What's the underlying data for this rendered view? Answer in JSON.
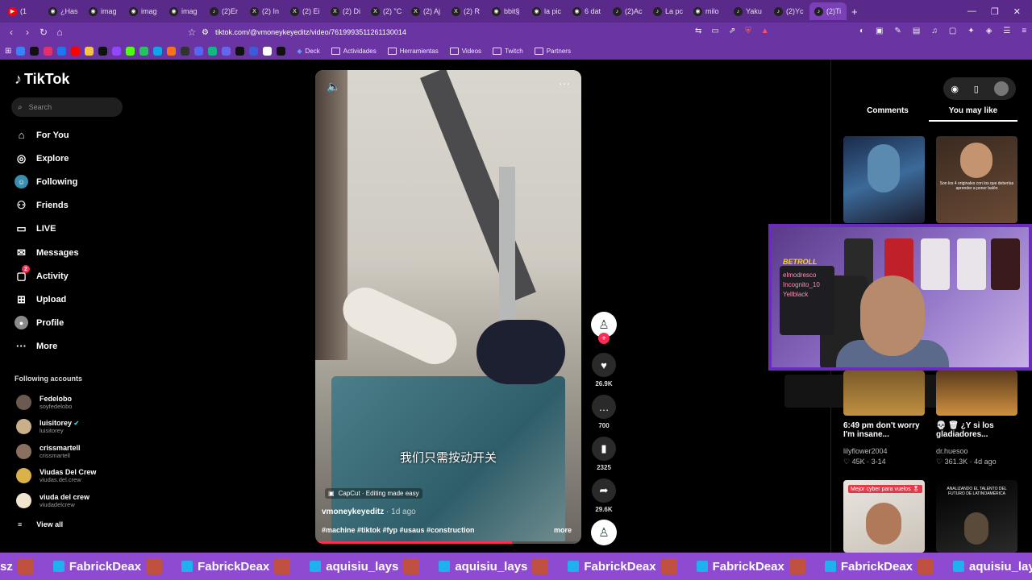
{
  "browser": {
    "tabs": [
      {
        "label": "(1",
        "icon": "youtube-icon"
      },
      {
        "label": "¿Has",
        "icon": "tab-icon"
      },
      {
        "label": "imag",
        "icon": "tab-icon"
      },
      {
        "label": "imag",
        "icon": "tab-icon"
      },
      {
        "label": "imag",
        "icon": "tab-icon"
      },
      {
        "label": "(2)Er",
        "icon": "tiktok-icon"
      },
      {
        "label": "(2) In",
        "icon": "x-icon"
      },
      {
        "label": "(2) Ei",
        "icon": "x-icon"
      },
      {
        "label": "(2) Di",
        "icon": "x-icon"
      },
      {
        "label": "(2) \"C",
        "icon": "x-icon"
      },
      {
        "label": "(2) Aj",
        "icon": "x-icon"
      },
      {
        "label": "(2) R",
        "icon": "x-icon"
      },
      {
        "label": "bbit§",
        "icon": "tab-icon"
      },
      {
        "label": "la pic",
        "icon": "tab-icon"
      },
      {
        "label": "6 dat",
        "icon": "tab-icon"
      },
      {
        "label": "(2)Ac",
        "icon": "tiktok-icon"
      },
      {
        "label": "La pc",
        "icon": "tiktok-icon"
      },
      {
        "label": "milo",
        "icon": "tab-icon"
      },
      {
        "label": "Yaku",
        "icon": "tiktok-icon"
      },
      {
        "label": "(2)Yc",
        "icon": "tiktok-icon"
      },
      {
        "label": "(2)Ti",
        "icon": "tiktok-icon"
      }
    ],
    "url": "tiktok.com/@vmoneykeyeditz/video/7619993511261130014",
    "bookmarks": [
      "Deck",
      "Actividades",
      "Herramientas",
      "Videos",
      "Twitch",
      "Partners"
    ]
  },
  "tiktok": {
    "logo": "TikTok",
    "search_placeholder": "Search",
    "nav": [
      "For You",
      "Explore",
      "Following",
      "Friends",
      "LIVE",
      "Messages",
      "Activity",
      "Upload",
      "Profile",
      "More"
    ],
    "activity_badge": "2",
    "following_title": "Following accounts",
    "accounts": [
      {
        "name": "Fedelobo",
        "handle": "soyfedelobo"
      },
      {
        "name": "luisitorey",
        "handle": "luisitorey"
      },
      {
        "name": "crissmartell",
        "handle": "crissmartell"
      },
      {
        "name": "Viudas Del Crew",
        "handle": "viudas.del.crew"
      },
      {
        "name": "viuda del crew",
        "handle": "viudadelcrew"
      }
    ],
    "view_all": "View all"
  },
  "video": {
    "subtitle": "我们只需按动开关",
    "capcut": "CapCut · Editing made easy",
    "author": "vmoneykeyeditz",
    "date": " · 1d ago",
    "tags": "#machine #tiktok #fyp #usaus #construction",
    "more": "more",
    "progress_fraction": 0.74,
    "likes": "26.9K",
    "comments": "700",
    "saves": "2325",
    "shares": "29.6K"
  },
  "right": {
    "tabs": [
      "Comments",
      "You may like"
    ],
    "thumb2_caption": "Son los 4 originales con los que deberías aprender a poner balón",
    "items": [
      {
        "title": "6:49 pm don't worry I'm insane...",
        "user": "lilyflower2004",
        "stats": "♡ 45K · 3-14"
      },
      {
        "title": "💀 🗑 ¿Y si los gladiadores...",
        "user": "dr.huesoo",
        "stats": "♡ 361.3K · 4d ago"
      }
    ],
    "thumb3_caption": "Mejor cyber para vuelos 🎖",
    "thumb4_caption": "ANALIZANDO EL TALENTO DEL FUTURO DE LATINOAMÉRICA"
  },
  "stream": {
    "overlay": "BETROLL",
    "board_lines": [
      "elmodresco",
      "Incognito_10",
      "Yellblack"
    ],
    "ticker": [
      "sz",
      "FabrickDeax",
      "FabrickDeax",
      "aquisiu_lays",
      "aquisiu_lays",
      "FabrickDeax",
      "FabrickDeax",
      "FabrickDeax",
      "aquisiu_lays"
    ]
  }
}
